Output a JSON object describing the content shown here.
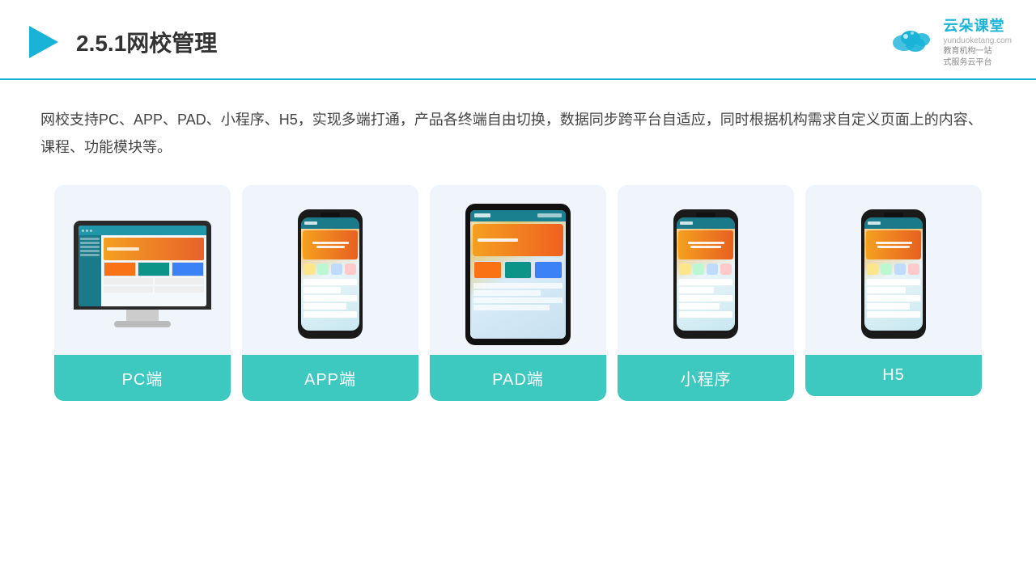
{
  "header": {
    "title": "2.5.1网校管理",
    "brand_name": "云朵课堂",
    "brand_url": "yunduoketang.com",
    "brand_tagline_line1": "教育机构一站",
    "brand_tagline_line2": "式服务云平台"
  },
  "description": {
    "text": "网校支持PC、APP、PAD、小程序、H5，实现多端打通，产品各终端自由切换，数据同步跨平台自适应，同时根据机构需求自定义页面上的内容、课程、功能模块等。"
  },
  "cards": [
    {
      "id": "pc",
      "label": "PC端"
    },
    {
      "id": "app",
      "label": "APP端"
    },
    {
      "id": "pad",
      "label": "PAD端"
    },
    {
      "id": "miniapp",
      "label": "小程序"
    },
    {
      "id": "h5",
      "label": "H5"
    }
  ],
  "colors": {
    "accent": "#3dc8c0",
    "header_line": "#1ab3d8",
    "brand_color": "#1ab3d8"
  }
}
